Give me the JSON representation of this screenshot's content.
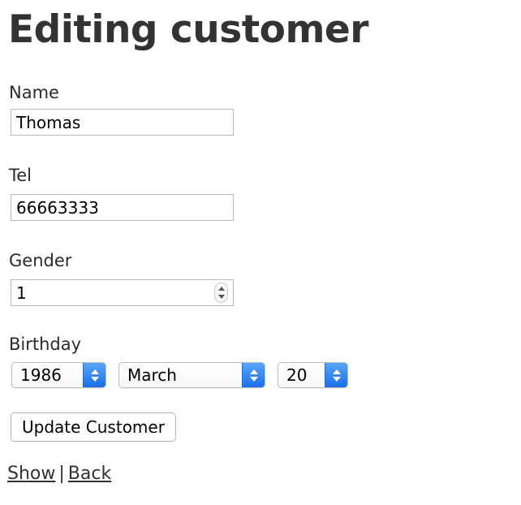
{
  "page": {
    "title": "Editing customer"
  },
  "form": {
    "name": {
      "label": "Name",
      "value": "Thomas",
      "placeholder": ""
    },
    "tel": {
      "label": "Tel",
      "value": "66663333",
      "placeholder": ""
    },
    "gender": {
      "label": "Gender",
      "value": "1",
      "placeholder": ""
    },
    "birthday": {
      "label": "Birthday",
      "year": "1986",
      "month": "March",
      "day": "20"
    },
    "submit_label": "Update Customer"
  },
  "links": {
    "show": "Show",
    "separator": "|",
    "back": "Back"
  },
  "colors": {
    "heading": "#333333",
    "label": "#2b2b2b",
    "input_border": "#b9b9b9",
    "select_button_top": "#59a6f8",
    "select_button_bottom": "#1b6fe6",
    "link": "#333333"
  }
}
